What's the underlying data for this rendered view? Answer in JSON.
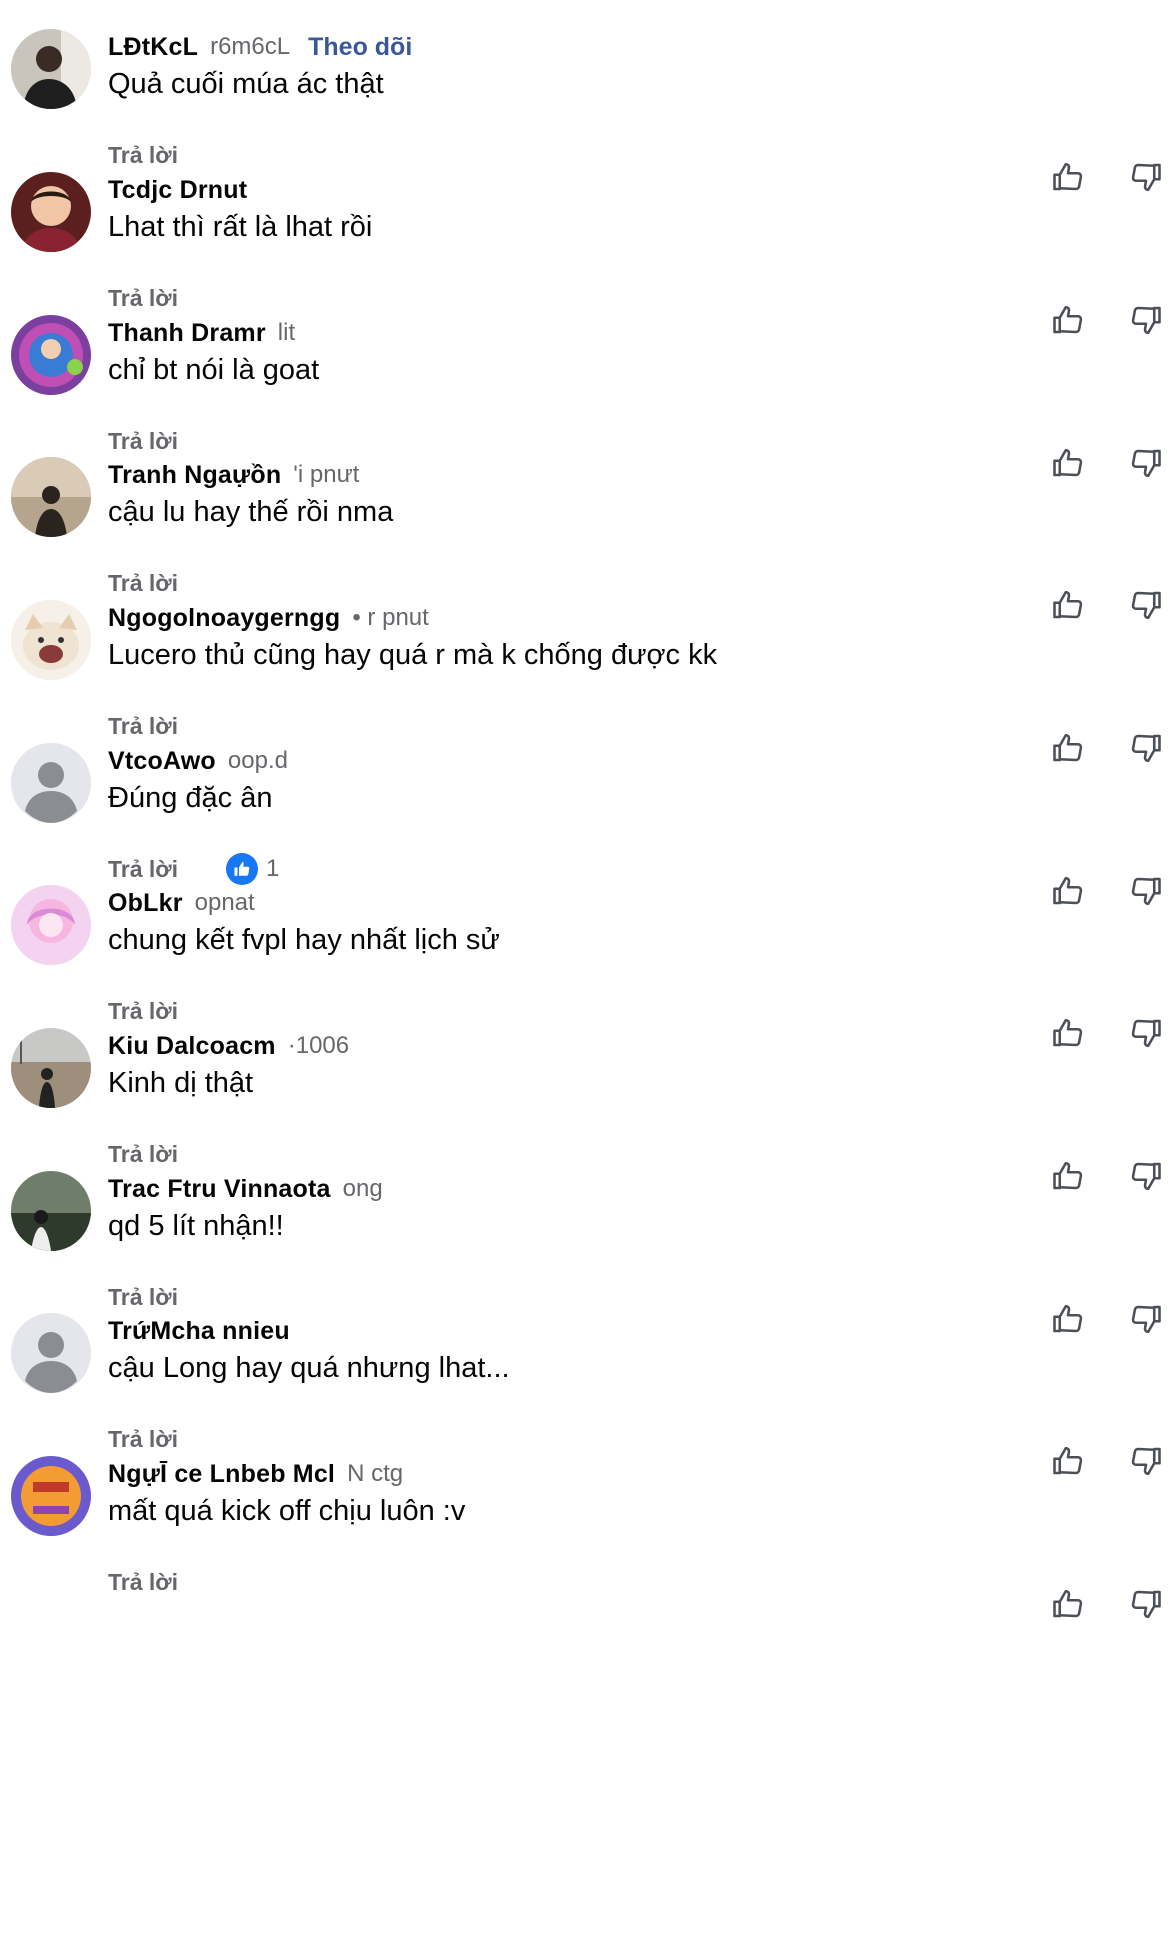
{
  "reply_label": "Trả lời",
  "follow_label": "Theo dõi",
  "colors": {
    "link_blue": "#385898",
    "reaction_blue": "#1877f2",
    "meta_gray": "#65676b",
    "text": "#050505"
  },
  "icons": {
    "like": "thumbs-up-icon",
    "dislike": "thumbs-down-icon",
    "reaction": "like-reaction-icon"
  },
  "comments": [
    {
      "author": "LĐtKcL",
      "time": "r6m6cL",
      "text": "Quả cuối múa ác thật",
      "show_follow": true,
      "reaction_count": ""
    },
    {
      "author": "Tcdjc Drnut",
      "time": "",
      "text": "Lhat thì rất là lhat rồi",
      "show_follow": false,
      "reaction_count": ""
    },
    {
      "author": "Thanh Dramr",
      "time": "lit",
      "text": "chỉ bt nói là goat",
      "show_follow": false,
      "reaction_count": ""
    },
    {
      "author": "Tranh Ngaựồn",
      "time": "'i pnưt",
      "text": "cậu lu hay thế rồi nma",
      "show_follow": false,
      "reaction_count": ""
    },
    {
      "author": "Ngogolnoaygerngg",
      "time": "• r pnut",
      "text": "Lucero thủ cũng hay quá r mà k chống được kk",
      "show_follow": false,
      "reaction_count": ""
    },
    {
      "author": "VtcoAwo",
      "time": "oop.d",
      "text": "Đúng đặc ân",
      "show_follow": false,
      "reaction_count": "1"
    },
    {
      "author": "ObLkr",
      "time": "opnat",
      "text": "chung kết fvpl hay nhất lịch sử",
      "show_follow": false,
      "reaction_count": ""
    },
    {
      "author": "Kiu Dalcoacm",
      "time": "·1006",
      "text": "Kinh dị thật",
      "show_follow": false,
      "reaction_count": ""
    },
    {
      "author": "Trac Ftru Vinnaota",
      "time": "ong",
      "text": "qd 5 lít nhận!!",
      "show_follow": false,
      "reaction_count": ""
    },
    {
      "author": "TrứMcha nnieu",
      "time": "",
      "text": "cậu Long hay quá nhưng lhat...",
      "show_follow": false,
      "reaction_count": ""
    },
    {
      "author": "NgựĪ ce Lnbeb Mcl",
      "time": "N ctg",
      "text": "mất quá kick off chịu luôn :v",
      "show_follow": false,
      "reaction_count": ""
    }
  ]
}
